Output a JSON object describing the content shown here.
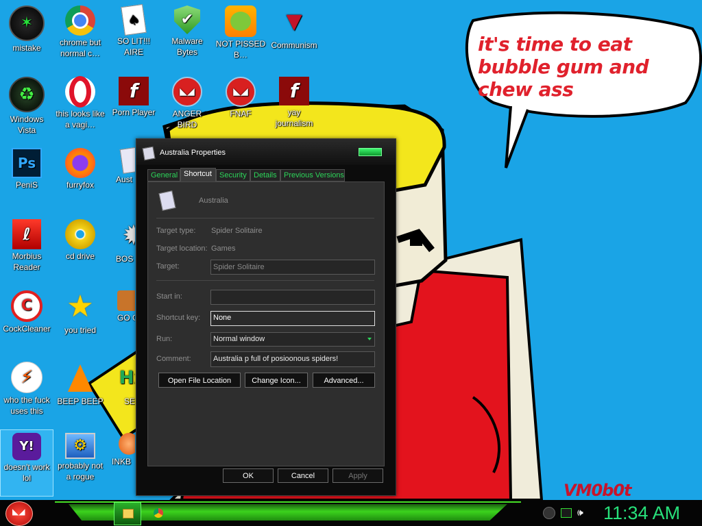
{
  "wallpaper": {
    "speech_bubble_text": "it's time to eat bubble gum and chew ass",
    "signature": "VM0b0t"
  },
  "desktop_icons": [
    {
      "label": "mistake",
      "icon": "razer-icon"
    },
    {
      "label": "chrome but normal c…",
      "icon": "chrome-icon"
    },
    {
      "label": "SO LIT!!! AIRE",
      "icon": "solitaire-icon"
    },
    {
      "label": "Malware Bytes",
      "icon": "shield-icon"
    },
    {
      "label": "NOT PISSED B…",
      "icon": "angry-pig-icon"
    },
    {
      "label": "Communism",
      "icon": "emblem-icon"
    },
    {
      "label": "Windows Vista",
      "icon": "recycle-icon"
    },
    {
      "label": "this looks like a vagi…",
      "icon": "opera-icon"
    },
    {
      "label": "Porn Player",
      "icon": "flash-icon"
    },
    {
      "label": "ANGER BIRD",
      "icon": "angry-bird-icon"
    },
    {
      "label": "FNAF",
      "icon": "angry-bird-icon"
    },
    {
      "label": "yay journalism",
      "icon": "flash-icon"
    },
    {
      "label": "PeniS",
      "icon": "photoshop-icon"
    },
    {
      "label": "furryfox",
      "icon": "firefox-icon"
    },
    {
      "label": "Aust",
      "icon": "solitaire-icon"
    },
    {
      "label": "Morbius Reader",
      "icon": "acrobat-icon"
    },
    {
      "label": "cd drive",
      "icon": "cd-icon"
    },
    {
      "label": "BOS SIMUL",
      "icon": "gear-icon"
    },
    {
      "label": "CockCleaner",
      "icon": "ccleaner-icon"
    },
    {
      "label": "you tried",
      "icon": "star-icon"
    },
    {
      "label": "GO GADG",
      "icon": "briefcase-icon"
    },
    {
      "label": "who the fuck uses this",
      "icon": "lightning-icon"
    },
    {
      "label": "BEEP BEEP",
      "icon": "vlc-icon"
    },
    {
      "label": "SE EDIT",
      "icon": "hex-editor-icon"
    },
    {
      "label": "doesn't work lol",
      "icon": "yahoo-icon"
    },
    {
      "label": "probably not a rogue",
      "icon": "computer-gear-icon"
    },
    {
      "label": "INKB",
      "icon": "balloon-icon"
    }
  ],
  "dialog": {
    "title": "Australia Properties",
    "tabs": [
      "General",
      "Shortcut",
      "Security",
      "Details",
      "Previous Versions"
    ],
    "active_tab": "Shortcut",
    "shortcut_name": "Australia",
    "target_type_label": "Target type:",
    "target_type_value": "Spider Solitaire",
    "target_location_label": "Target location:",
    "target_location_value": "Games",
    "target_label": "Target:",
    "target_value": "Spider Solitaire",
    "start_in_label": "Start in:",
    "start_in_value": "",
    "shortcut_key_label": "Shortcut key:",
    "shortcut_key_value": "None",
    "run_label": "Run:",
    "run_value": "Normal window",
    "comment_label": "Comment:",
    "comment_value": "Australia p full of posioonous spiders!",
    "btn_open_location": "Open File Location",
    "btn_change_icon": "Change Icon...",
    "btn_advanced": "Advanced...",
    "btn_ok": "OK",
    "btn_cancel": "Cancel",
    "btn_apply": "Apply"
  },
  "taskbar": {
    "clock": "11:34 AM",
    "accent": "#3bd31d"
  }
}
